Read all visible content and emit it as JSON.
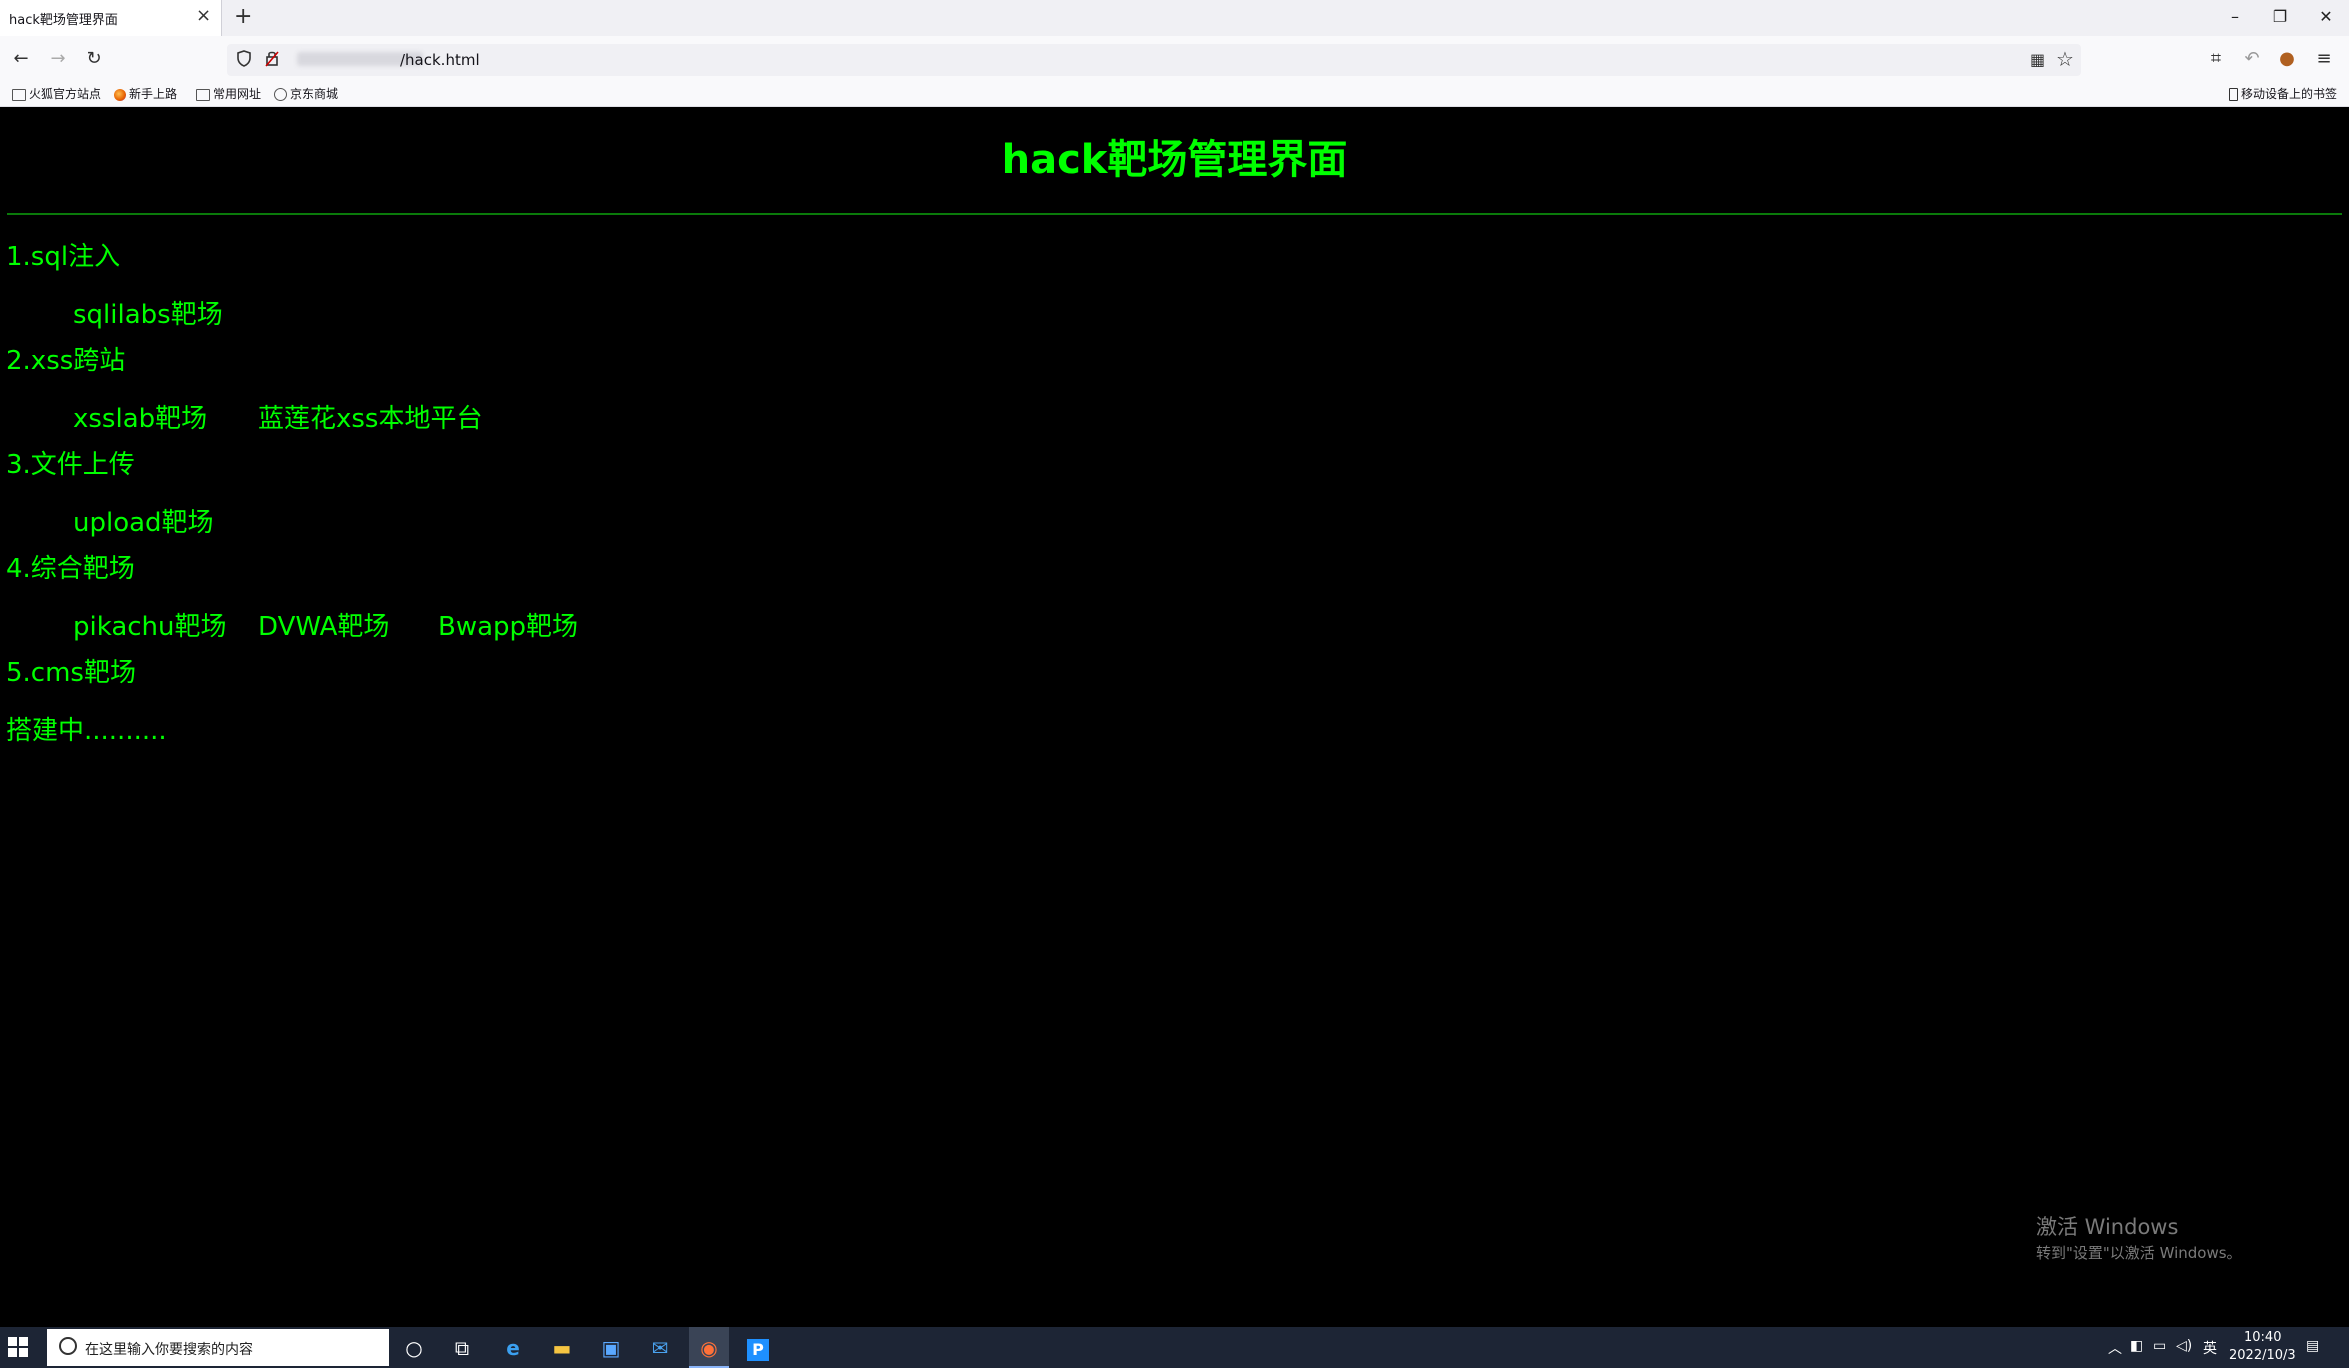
{
  "browser": {
    "tab_title": "hack靶场管理界面",
    "url_suffix": "/hack.html",
    "bookmarks": [
      "火狐官方站点",
      "新手上路",
      "常用网址",
      "京东商城"
    ],
    "mobile_bookmarks": "移动设备上的书签"
  },
  "page": {
    "heading": "hack靶场管理界面",
    "sections": [
      {
        "title": "1.sql注入",
        "links": [
          "sqlilabs靶场"
        ]
      },
      {
        "title": "2.xss跨站",
        "links": [
          "xsslab靶场",
          "蓝莲花xss本地平台"
        ]
      },
      {
        "title": "3.文件上传",
        "links": [
          "upload靶场"
        ]
      },
      {
        "title": "4.综合靶场",
        "links": [
          "pikachu靶场",
          "DVWA靶场",
          "Bwapp靶场"
        ]
      },
      {
        "title": "5.cms靶场",
        "links": []
      }
    ],
    "footer_text": "搭建中..........",
    "text_color": "#00ff00",
    "background_color": "#000000"
  },
  "watermark": {
    "line1": "激活 Windows",
    "line2": "转到\"设置\"以激活 Windows。"
  },
  "taskbar": {
    "search_placeholder": "在这里输入你要搜索的内容",
    "tray_lang": "英",
    "time": "10:40",
    "date": "2022/10/3",
    "apps": [
      "cortana-icon",
      "task-view-icon",
      "edge-icon",
      "file-explorer-icon",
      "store-icon",
      "mail-icon",
      "firefox-icon",
      "pycharm-icon"
    ]
  }
}
